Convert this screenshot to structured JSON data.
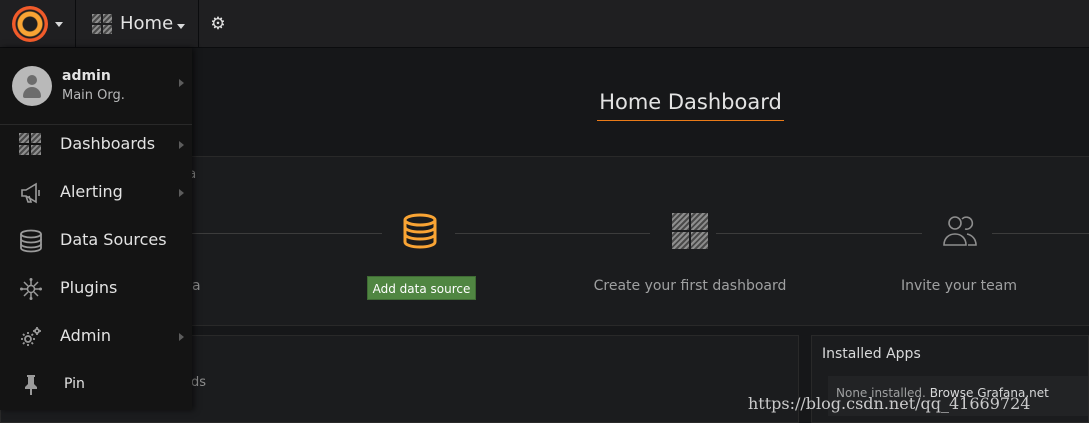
{
  "topbar": {
    "home_label": "Home",
    "icons": {
      "logo": "grafana-logo",
      "home": "dashboard-grid-icon",
      "settings": "gear-icon"
    }
  },
  "dashboard": {
    "title": "Home Dashboard",
    "steps": [
      {
        "label": "Add data source",
        "icon": "database-icon",
        "state": "active"
      },
      {
        "label": "Create your first dashboard",
        "icon": "dashboard-grid-icon"
      },
      {
        "label": "Invite your team",
        "icon": "users-icon"
      }
    ],
    "partially_hidden": {
      "panel_heading_tail": "na",
      "step_tail": "a",
      "lower_tail": "ds"
    }
  },
  "installed_apps": {
    "title": "Installed Apps",
    "empty_text": "None installed.",
    "browse_link": "Browse Grafana.net"
  },
  "sidemenu": {
    "user": {
      "name": "admin",
      "org": "Main Org."
    },
    "items": [
      {
        "label": "Dashboards",
        "icon": "dashboard-grid-icon",
        "has_submenu": true
      },
      {
        "label": "Alerting",
        "icon": "megaphone-icon",
        "has_submenu": true
      },
      {
        "label": "Data Sources",
        "icon": "database-icon",
        "has_submenu": false
      },
      {
        "label": "Plugins",
        "icon": "plugins-icon",
        "has_submenu": false
      },
      {
        "label": "Admin",
        "icon": "cogs-icon",
        "has_submenu": true
      },
      {
        "label": "Pin",
        "icon": "pin-icon",
        "has_submenu": false
      }
    ]
  },
  "watermark": "https://blog.csdn.net/qq_41669724",
  "colors": {
    "accent": "#eb7b18",
    "button_green": "#508642",
    "background": "#161719"
  }
}
